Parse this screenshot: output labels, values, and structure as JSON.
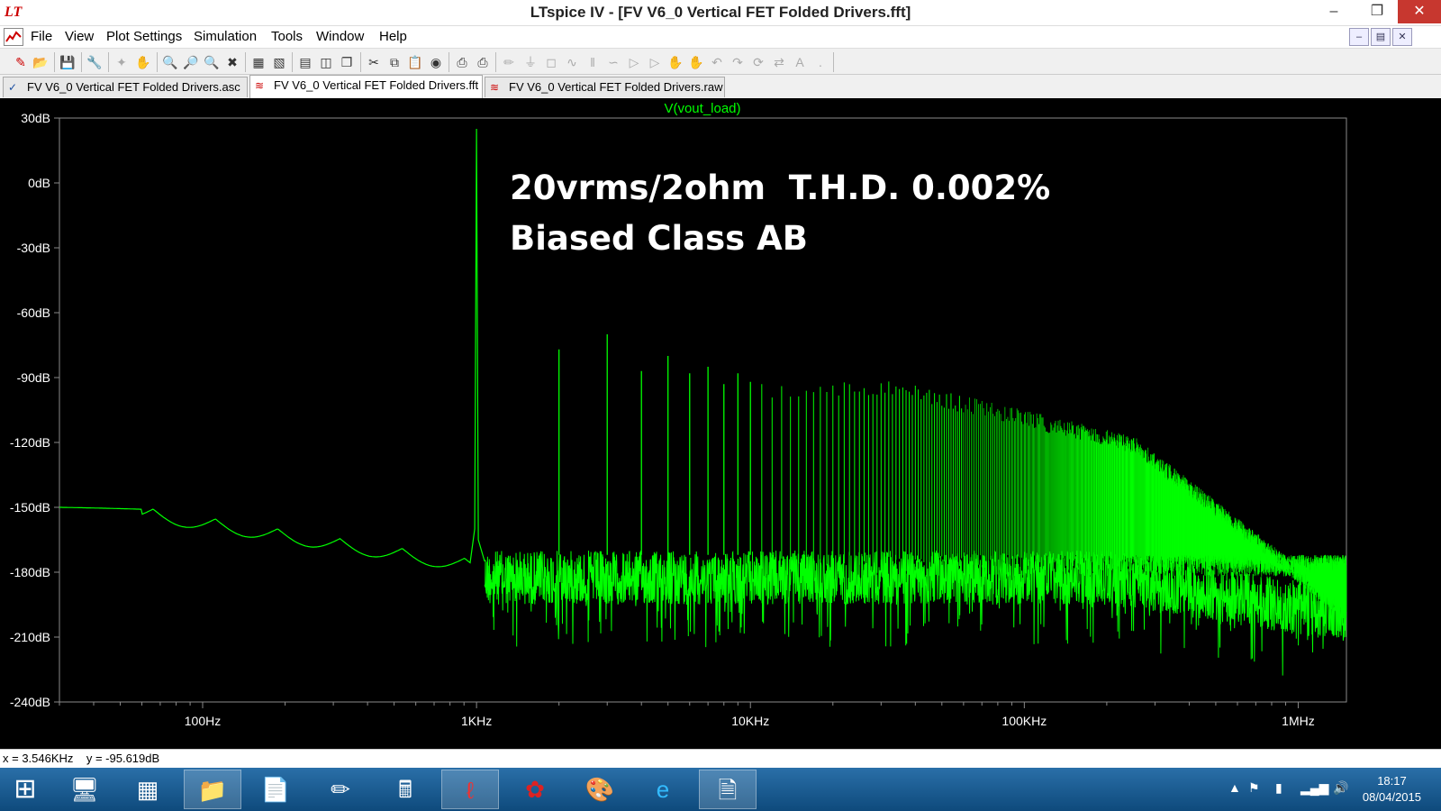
{
  "window": {
    "title": "LTspice IV - [FV V6_0 Vertical FET Folded Drivers.fft]",
    "app_glyph": "LT"
  },
  "menu": [
    "File",
    "View",
    "Plot Settings",
    "Simulation",
    "Tools",
    "Window",
    "Help"
  ],
  "tabs": [
    {
      "label": "FV V6_0 Vertical FET Folded Drivers.asc",
      "icon": "schematic-icon",
      "active": false
    },
    {
      "label": "FV V6_0 Vertical FET Folded Drivers.fft",
      "icon": "waveform-icon",
      "active": true
    },
    {
      "label": "FV V6_0 Vertical FET Folded Drivers.raw",
      "icon": "waveform-icon",
      "active": false
    }
  ],
  "plot": {
    "trace_label": "V(vout_load)",
    "annotation_line1": "20vrms/2ohm  T.H.D. 0.002%",
    "annotation_line2": "Biased Class AB",
    "trace_color": "#00ff00",
    "background": "#000000"
  },
  "chart_data": {
    "type": "line",
    "title": "V(vout_load)",
    "x_scale": "log",
    "xlim_hz": [
      30,
      1500000
    ],
    "ylim_db": [
      -240,
      30
    ],
    "y_ticks": [
      "30dB",
      "0dB",
      "-30dB",
      "-60dB",
      "-90dB",
      "-120dB",
      "-150dB",
      "-180dB",
      "-210dB",
      "-240dB"
    ],
    "x_ticks": [
      "100Hz",
      "1KHz",
      "10KHz",
      "100KHz",
      "1MHz"
    ],
    "fundamental": {
      "freq_hz": 1000,
      "db": 25
    },
    "harmonics_db": [
      {
        "n": 2,
        "db": -77
      },
      {
        "n": 3,
        "db": -70
      },
      {
        "n": 4,
        "db": -87
      },
      {
        "n": 5,
        "db": -80
      },
      {
        "n": 6,
        "db": -88
      },
      {
        "n": 7,
        "db": -85
      },
      {
        "n": 8,
        "db": -93
      },
      {
        "n": 9,
        "db": -88
      },
      {
        "n": 10,
        "db": -92
      }
    ],
    "noise_floor_db": -170
  },
  "status": {
    "cursor_readout": "x = 3.546KHz    y = -95.619dB"
  },
  "taskbar": {
    "time": "18:17",
    "date": "08/04/2015"
  },
  "colors": {
    "accent": "#00ff00",
    "taskbar": "#1a5d95"
  }
}
